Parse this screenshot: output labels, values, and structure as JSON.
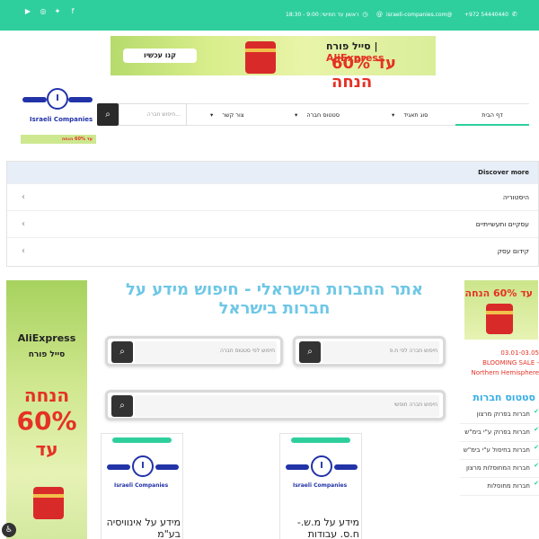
{
  "topbar": {
    "phone": "+972 54440440",
    "email": "israeli-companies.com@",
    "hours": "ראשון עד חמישי: 9:00 - 18:30",
    "social": [
      "facebook-icon",
      "twitter-icon",
      "instagram-icon",
      "youtube-icon"
    ]
  },
  "top_banner": {
    "brand": "AliExpress",
    "sale": "סייל פורח",
    "discount": "עד 60% הנחה",
    "cta": "קנו עכשיו"
  },
  "logo": {
    "text": "Israeli Companies",
    "letter": "I"
  },
  "mini_banner": {
    "text": "עד 60% הנחה"
  },
  "header": {
    "search_placeholder": "חיפוש חברה..."
  },
  "nav": {
    "items": [
      {
        "label": "דף הבית"
      },
      {
        "label": "סוג תאגיד"
      },
      {
        "label": "סטטוס חברה"
      },
      {
        "label": "צור קשר"
      }
    ]
  },
  "discover": {
    "title": "Discover more",
    "items": [
      "היסטוריה",
      "עסקיים ותעשייתיים",
      "קידום עסק"
    ]
  },
  "main": {
    "title": "אתר החברות הישראלי - חיפוש מידע על חברות בישראל",
    "search_by_number": "חיפוש חברה לפי ח.פ",
    "search_by_status": "חיפוש לפי סטטוס חברה",
    "free_search": "חיפוש חברה חופשי",
    "cards": [
      {
        "name": "מידע על מ.ש.- ח.ס. עבודות"
      },
      {
        "name": "מידע על אינוויסיה בע\"מ"
      }
    ]
  },
  "left_ad": {
    "brand": "AliExpress",
    "sale": "סייל פורח",
    "line1": "הנחה",
    "line2": "60%",
    "line3": "עד"
  },
  "right_ad": {
    "discount": "עד 60% הנחה"
  },
  "bloom_sale": {
    "dates": "03.01-03.05",
    "name": "BLOOMING SALE -",
    "region": "Northern Hemisphere"
  },
  "status_section": {
    "title": "סטטוס חברות",
    "items": [
      "חברות בפרוק מרצון",
      "חברות בפרוק ע\"י בימ\"ש",
      "חברות בחיסול ע\"י בימ\"ש",
      "חברות המחוסלות מרצון",
      "חברות מחוסלות"
    ]
  },
  "colors": {
    "accent": "#2fcf9d",
    "title": "#6fc7e6",
    "sale_red": "#e43225",
    "logo_blue": "#2233a8"
  }
}
